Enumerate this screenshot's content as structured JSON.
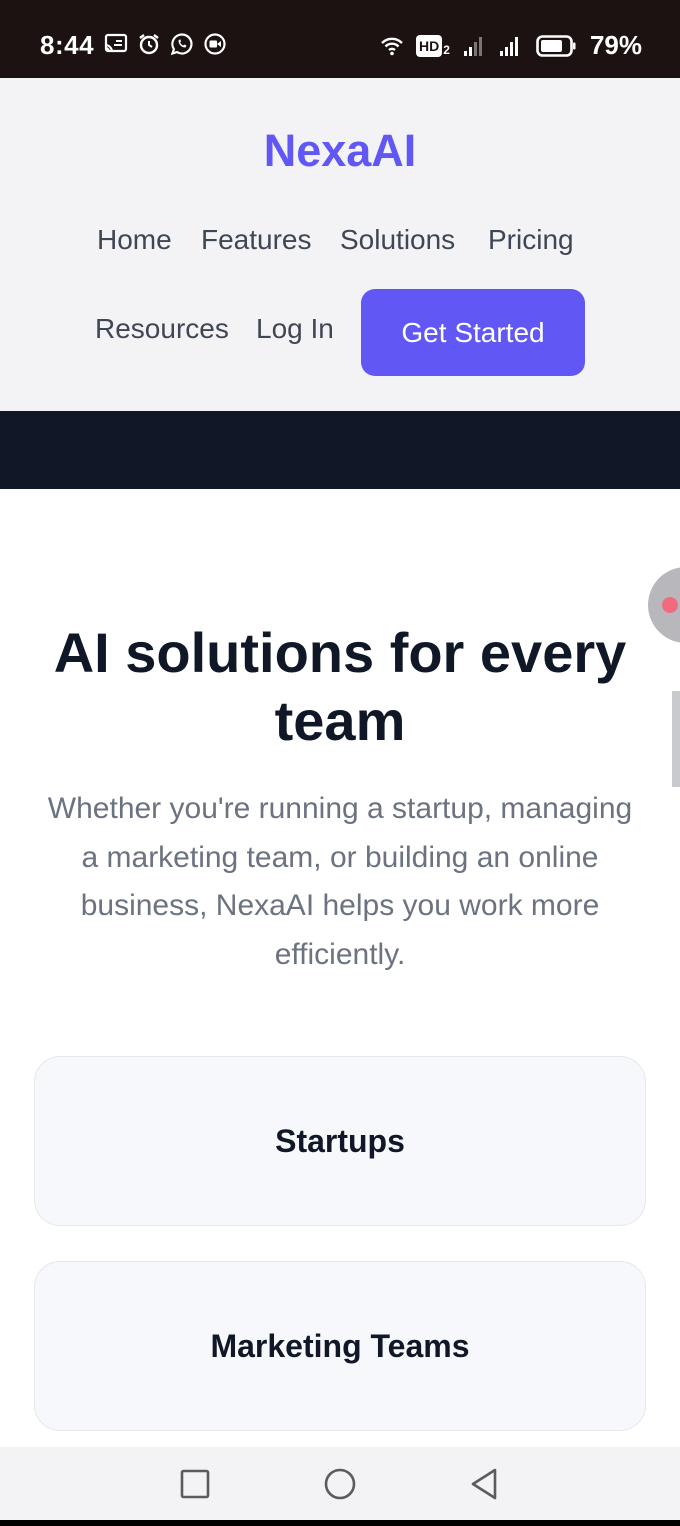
{
  "status_bar": {
    "time": "8:44",
    "network": "HD",
    "network_sub": "2",
    "battery": "79%",
    "left_icons": [
      "cast-icon",
      "alarm-icon",
      "whatsapp-icon",
      "video-record-icon"
    ],
    "right_icons": [
      "wifi-icon",
      "hd-voice-icon",
      "signal-icon",
      "signal-icon",
      "battery-icon"
    ]
  },
  "header": {
    "brand": "NexaAI",
    "nav": {
      "home": "Home",
      "features": "Features",
      "solutions": "Solutions",
      "pricing": "Pricing",
      "resources": "Resources",
      "login": "Log In"
    },
    "cta": "Get Started"
  },
  "hero": {
    "title": "AI solutions for every team",
    "subtitle": "Whether you're running a startup, managing a marketing team, or building an online business, NexaAI helps you work more efficiently."
  },
  "cards": [
    {
      "title": "Startups"
    },
    {
      "title": "Marketing Teams"
    }
  ],
  "colors": {
    "brand": "#6157f5",
    "dark_band": "#101827",
    "status_bar": "#1c1212",
    "heading": "#101827",
    "body_text": "#6b7280",
    "header_bg": "#f3f3f5"
  },
  "system_nav": {
    "recent": "square-icon",
    "home": "circle-icon",
    "back": "triangle-back-icon"
  }
}
